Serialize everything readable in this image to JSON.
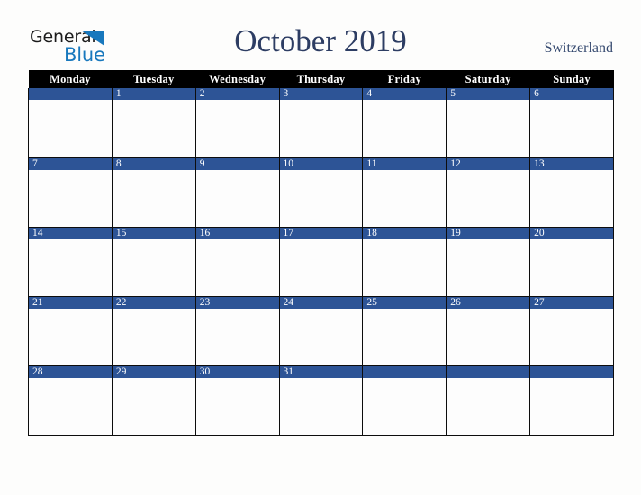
{
  "brand": {
    "line1": "General",
    "line2": "Blue",
    "triangle_icon": "triangle-icon",
    "line1_color": "#1b1b1b",
    "line2_color": "#1878bd",
    "triangle_color": "#1878bd"
  },
  "header": {
    "title": "October 2019",
    "month": "October",
    "year": "2019",
    "region": "Switzerland",
    "title_color": "#2d3d63",
    "region_color": "#35496f"
  },
  "calendar": {
    "weekday_headers": [
      "Monday",
      "Tuesday",
      "Wednesday",
      "Thursday",
      "Friday",
      "Saturday",
      "Sunday"
    ],
    "header_bg": "#000000",
    "header_text_color": "#ffffff",
    "daybar_bg": "#2d5496",
    "daybar_text_color": "#ffffff",
    "cell_bg": "#fdfdfd",
    "border_color": "#0d0d0d",
    "page_bg": "#fdfdfc",
    "weeks": [
      [
        {
          "day": ""
        },
        {
          "day": "1"
        },
        {
          "day": "2"
        },
        {
          "day": "3"
        },
        {
          "day": "4"
        },
        {
          "day": "5"
        },
        {
          "day": "6"
        }
      ],
      [
        {
          "day": "7"
        },
        {
          "day": "8"
        },
        {
          "day": "9"
        },
        {
          "day": "10"
        },
        {
          "day": "11"
        },
        {
          "day": "12"
        },
        {
          "day": "13"
        }
      ],
      [
        {
          "day": "14"
        },
        {
          "day": "15"
        },
        {
          "day": "16"
        },
        {
          "day": "17"
        },
        {
          "day": "18"
        },
        {
          "day": "19"
        },
        {
          "day": "20"
        }
      ],
      [
        {
          "day": "21"
        },
        {
          "day": "22"
        },
        {
          "day": "23"
        },
        {
          "day": "24"
        },
        {
          "day": "25"
        },
        {
          "day": "26"
        },
        {
          "day": "27"
        }
      ],
      [
        {
          "day": "28"
        },
        {
          "day": "29"
        },
        {
          "day": "30"
        },
        {
          "day": "31"
        },
        {
          "day": ""
        },
        {
          "day": ""
        },
        {
          "day": ""
        }
      ]
    ]
  }
}
